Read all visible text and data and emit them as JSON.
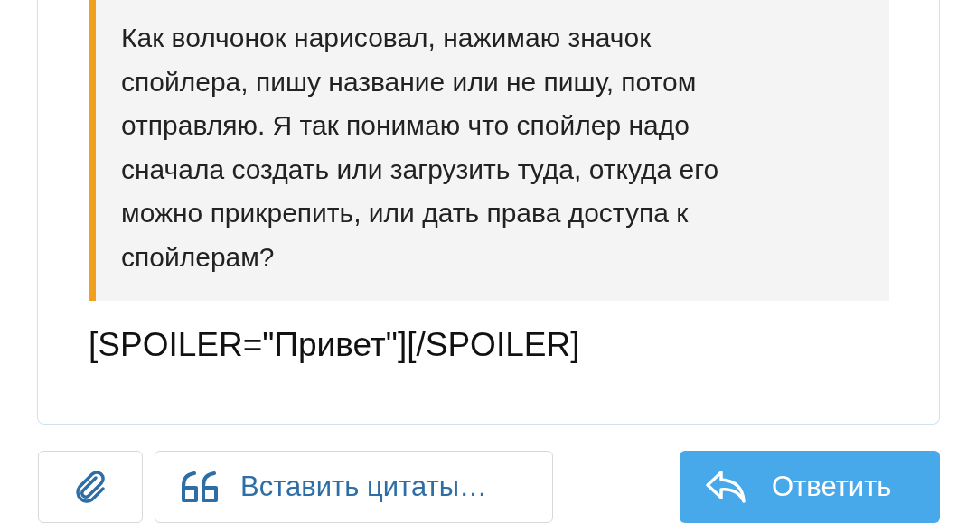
{
  "quote": {
    "lines": [
      "Как волчонок нарисовал, нажимаю значок",
      "спойлера, пишу название или не пишу, потом",
      "отправляю. Я так понимаю что спойлер надо",
      "сначала создать или загрузить туда, откуда его",
      "можно прикрепить, или дать права доступа к",
      "спойлерам?"
    ]
  },
  "editor_text": "[SPOILER=\"Привет\"][/SPOILER]",
  "buttons": [
    {
      "kind": "attach"
    },
    {
      "kind": "quote",
      "label": "Вставить цитаты…"
    },
    {
      "kind": "reply",
      "label": "Ответить"
    }
  ]
}
